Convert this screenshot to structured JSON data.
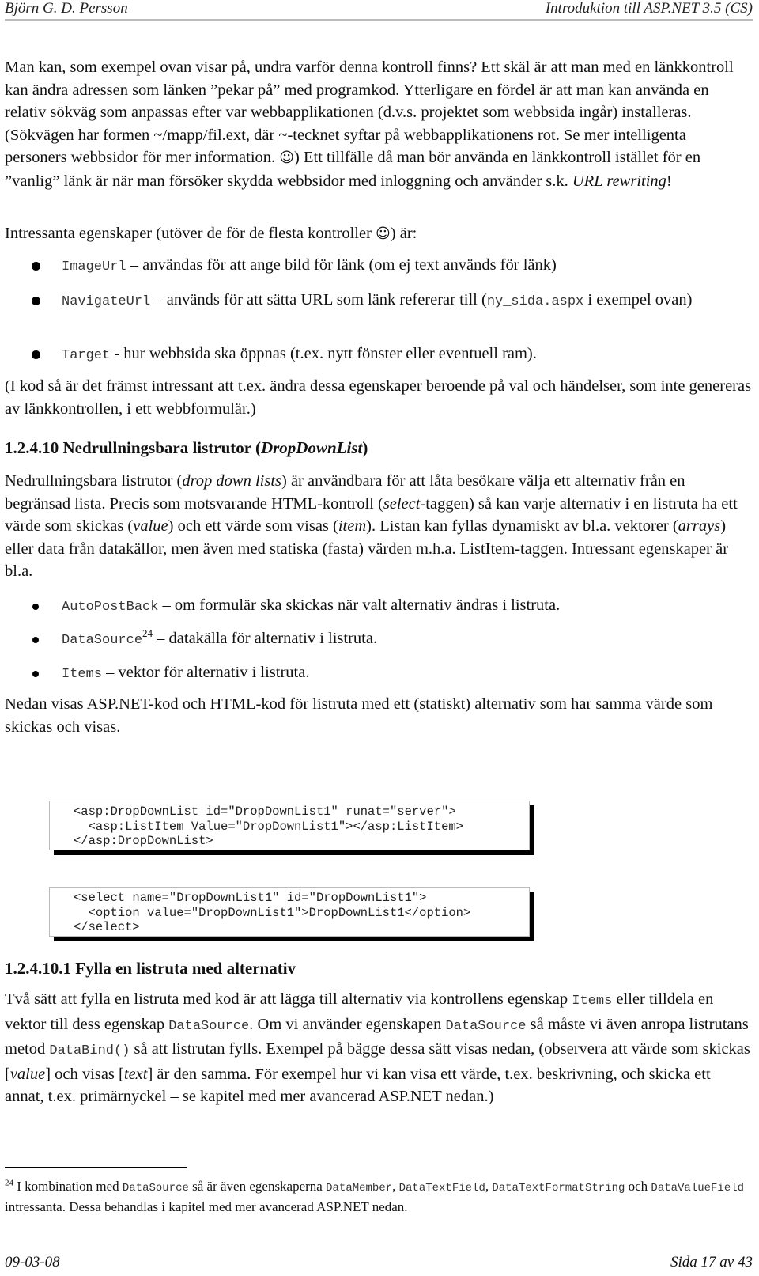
{
  "header": {
    "author": "Björn G. D. Persson",
    "doc_title": "Introduktion till ASP.NET 3.5 (CS)"
  },
  "p1": {
    "t1": "Man kan, som exempel ovan visar på, undra varför denna kontroll finns? Ett skäl är att man med en länkkontroll kan ändra adressen som länken ”pekar på” med programkod. Ytterligare en fördel är att man kan använda en relativ sökväg som anpassas efter var webbapplikationen (d.v.s. projektet som webbsida ingår) installeras. (Sökvägen har formen ~/mapp/fil.ext, där ~-tecknet syftar på webbapplikationens rot. Se mer intelligenta personers webbsidor för mer information. ",
    "smiley": "☺",
    "t2": ") Ett tillfälle då man bör använda en länkkontroll istället för en ”vanlig” länk är när man försöker skydda webbsidor med inloggning och använder s.k. ",
    "em": "URL rewriting",
    "t3": "!"
  },
  "p2": {
    "t1": "Intressanta egenskaper (utöver de för de flesta kontroller ",
    "smiley": "☺",
    "t2": ") är:"
  },
  "link_props": [
    {
      "code": "ImageUrl",
      "text": " – användas för att ange bild för länk (om ej text används för länk)"
    },
    {
      "code": "NavigateUrl",
      "text": " – används för att sätta URL som länk refererar till (",
      "code2": "ny_sida.aspx",
      "text2": " i exempel ovan)"
    },
    {
      "code": "Target",
      "text": " - hur webbsida ska öppnas (t.ex. nytt fönster eller eventuell ram)."
    }
  ],
  "p3": "(I kod så är det främst intressant att t.ex. ändra dessa egenskaper beroende på val och händelser, som inte genereras av länkkontrollen, i ett webbformulär.)",
  "section1": {
    "number": "1.2.4.10 ",
    "title": "Nedrullningsbara listrutor (",
    "title_em": "DropDownList",
    "title_end": ")"
  },
  "p4": {
    "a": "Nedrullningsbara listrutor (",
    "a_em": "drop down lists",
    "b": ") är användbara för att låta besökare välja ett alternativ från en begränsad lista. Precis som motsvarande HTML-kontroll (",
    "b_em": "select",
    "c": "-taggen) så kan varje alternativ i en listruta ha ett värde som skickas (",
    "c_em": "value",
    "d": ") och ett värde som visas (",
    "d_em": "item",
    "e": "). Listan kan fyllas dynamiskt av bl.a. vektorer (",
    "e_em": "arrays",
    "f": ") eller data från datakällor, men även med statiska (fasta) värden m.h.a. ListItem-taggen. Intressant egenskaper är bl.a."
  },
  "ddl_props": [
    {
      "code": "AutoPostBack",
      "text": " – om formulär ska skickas när valt alternativ ändras i listruta."
    },
    {
      "code": "DataSource",
      "sup": "24",
      "text": " – datakälla för alternativ i listruta."
    },
    {
      "code": "Items",
      "text": " – vektor för alternativ i listruta."
    }
  ],
  "p5": "Nedan visas ASP.NET-kod och HTML-kod för listruta med ett (statiskt) alternativ som har samma värde som skickas och visas.",
  "code_asp": [
    "<asp:DropDownList id=\"DropDownList1\" runat=\"server\">",
    "  <asp:ListItem Value=\"DropDownList1\"></asp:ListItem>",
    "</asp:DropDownList>"
  ],
  "code_html": [
    "<select name=\"DropDownList1\" id=\"DropDownList1\">",
    "  <option value=\"DropDownList1\">DropDownList1</option>",
    "</select>"
  ],
  "section2": "1.2.4.10.1 Fylla en listruta med alternativ",
  "p6": {
    "a": "Två sätt att fylla en listruta med kod är att lägga till alternativ via kontrollens egenskap ",
    "a_code": "Items",
    "b": " eller tilldela en vektor till dess egenskap ",
    "b_code": "DataSource",
    "c": ". Om vi använder egenskapen ",
    "c_code": "DataSource",
    "d": " så måste vi även anropa listrutans metod ",
    "d_code": "DataBind()",
    "e": " så att listrutan fylls. Exempel på bägge dessa sätt visas nedan, (observera att värde som skickas [",
    "e_em": "value",
    "f": "] och visas [",
    "f_em": "text",
    "g": "] är den samma. För exempel hur vi kan visa ett värde, t.ex. beskrivning, och skicka ett annat, t.ex. primärnyckel – se kapitel med mer avancerad ASP.NET nedan.)"
  },
  "footnote": {
    "num": "24",
    "a": " I kombination med ",
    "a_code": "DataSource",
    "b": " så är även egenskaperna ",
    "c1": "DataMember",
    "sep1": ", ",
    "c2": "DataTextField",
    "sep2": ", ",
    "c3": "DataTextFormatString",
    "c": " och ",
    "c4": "DataValueField",
    "d": " intressanta. Dessa behandlas i kapitel med mer avancerad ASP.NET nedan."
  },
  "footer": {
    "date": "09-03-08",
    "page": "Sida 17 av 43"
  }
}
